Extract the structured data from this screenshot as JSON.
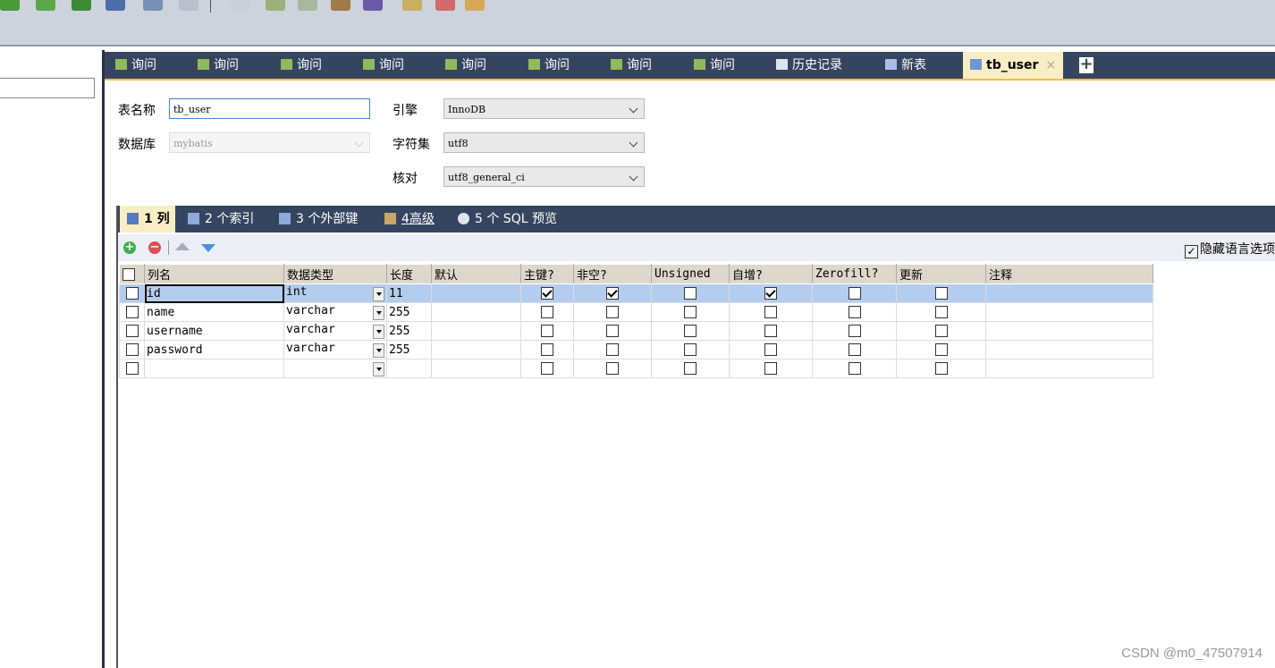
{
  "toolbar": {
    "icons": [
      "new-connection-icon",
      "new-query-icon",
      "import-icon",
      "export-icon",
      "table-icon",
      "view-icon",
      "check-icon",
      "backup-icon",
      "schedule-icon",
      "transfer-icon",
      "sync-icon",
      "key-icon",
      "report-icon",
      "model-icon"
    ]
  },
  "tabs": [
    {
      "label": "询问",
      "icon": "query-icon"
    },
    {
      "label": "询问",
      "icon": "query-icon"
    },
    {
      "label": "询问",
      "icon": "query-icon"
    },
    {
      "label": "询问",
      "icon": "query-icon"
    },
    {
      "label": "询问",
      "icon": "query-icon"
    },
    {
      "label": "询问",
      "icon": "query-icon"
    },
    {
      "label": "询问",
      "icon": "query-icon"
    },
    {
      "label": "询问",
      "icon": "query-icon"
    },
    {
      "label": "历史记录",
      "icon": "history-icon"
    },
    {
      "label": "新表",
      "icon": "table-icon"
    },
    {
      "label": "tb_user",
      "icon": "table-icon",
      "active": true,
      "close": "×"
    }
  ],
  "form": {
    "table_name_label": "表名称",
    "table_name_value": "tb_user",
    "database_label": "数据库",
    "database_value": "mybatis",
    "engine_label": "引擎",
    "engine_value": "InnoDB",
    "charset_label": "字符集",
    "charset_value": "utf8",
    "collation_label": "核对",
    "collation_value": "utf8_general_ci"
  },
  "subtabs": [
    {
      "label": "1 列",
      "active": true
    },
    {
      "label": "2 个索引"
    },
    {
      "label": "3 个外部键"
    },
    {
      "label": "4高级"
    },
    {
      "label": "5 个 SQL 预览"
    }
  ],
  "hide_language_option": {
    "label": "隐藏语言选项",
    "checked": true
  },
  "grid": {
    "headers": [
      "",
      "列名",
      "数据类型",
      "长度",
      "默认",
      "主键?",
      "非空?",
      "Unsigned",
      "自增?",
      "Zerofill?",
      "更新",
      "注释"
    ],
    "rows": [
      {
        "name": "id",
        "type": "int",
        "length": "11",
        "default": "",
        "pk": true,
        "notnull": true,
        "unsigned": false,
        "autoinc": true,
        "zerofill": false,
        "update": false,
        "comment": ""
      },
      {
        "name": "name",
        "type": "varchar",
        "length": "255",
        "default": "",
        "pk": false,
        "notnull": false,
        "unsigned": false,
        "autoinc": false,
        "zerofill": false,
        "update": false,
        "comment": ""
      },
      {
        "name": "username",
        "type": "varchar",
        "length": "255",
        "default": "",
        "pk": false,
        "notnull": false,
        "unsigned": false,
        "autoinc": false,
        "zerofill": false,
        "update": false,
        "comment": ""
      },
      {
        "name": "password",
        "type": "varchar",
        "length": "255",
        "default": "",
        "pk": false,
        "notnull": false,
        "unsigned": false,
        "autoinc": false,
        "zerofill": false,
        "update": false,
        "comment": ""
      },
      {
        "name": "",
        "type": "",
        "length": "",
        "default": "",
        "pk": false,
        "notnull": false,
        "unsigned": false,
        "autoinc": false,
        "zerofill": false,
        "update": false,
        "comment": ""
      }
    ]
  },
  "watermark": "CSDN @m0_47507914",
  "colors": {
    "tab_bar": "#36455f",
    "active_tab": "#f8edc4",
    "accent": "#f1c232",
    "selected_row": "#b4cdef"
  }
}
